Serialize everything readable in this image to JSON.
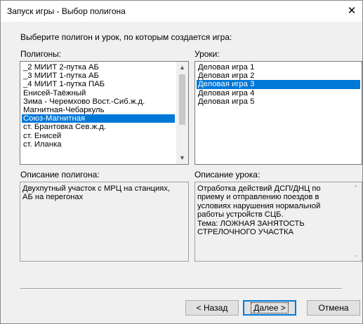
{
  "window": {
    "title": "Запуск игры - Выбор полигона",
    "close_glyph": "✕"
  },
  "instruction": "Выберите полигон и урок, по которым создается игра:",
  "polygons": {
    "label": "Полигоны:",
    "items": [
      "_2 МИИТ 2-путка АБ",
      "_3 МИИТ 1-путка АБ",
      "_4 МИИТ 1-путка ПАБ",
      "Енисей-Таёжный",
      "Зима - Черемхово Вост.-Сиб.ж.д.",
      "Магнитная-Чебаркуль",
      "Союз-Магнитная",
      "ст. Брантовка Сев.ж.д.",
      "ст. Енисей",
      "ст. Иланка"
    ],
    "selected_index": 6
  },
  "lessons": {
    "label": "Уроки:",
    "items": [
      "Деловая игра 1",
      "Деловая игра 2",
      "Деловая игра 3",
      "Деловая игра 4",
      "Деловая игра 5"
    ],
    "selected_index": 2
  },
  "polygon_description": {
    "label": "Описание полигона:",
    "text": "Двухпутный участок с МРЦ на станциях,\nАБ на перегонах"
  },
  "lesson_description": {
    "label": "Описание урока:",
    "text": "Отработка действий ДСП/ДНЦ по\nприему и отправлению поездов в\nусловиях нарушения нормальной\nработы устройств СЦБ.\nТема: ЛОЖНАЯ ЗАНЯТОСТЬ\nСТРЕЛОЧНОГО УЧАСТКА"
  },
  "buttons": {
    "back": "< Назад",
    "next": "Далее >",
    "cancel": "Отмена"
  },
  "colors": {
    "selection": "#0078d7",
    "dialog_bg": "#f0f0f0",
    "desktop_bg": "#5b6770"
  }
}
